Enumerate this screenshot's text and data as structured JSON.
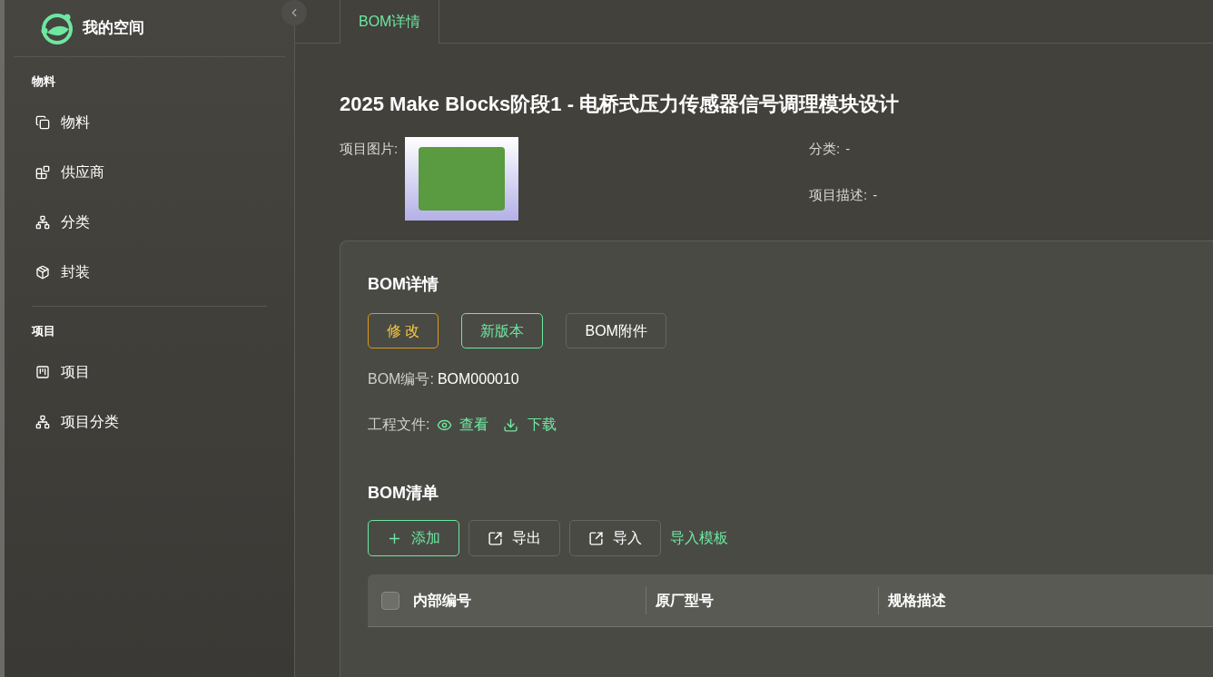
{
  "sidebar": {
    "title": "我的空间",
    "sections": [
      {
        "heading": "物料",
        "items": [
          {
            "label": "物料"
          },
          {
            "label": "供应商"
          },
          {
            "label": "分类"
          },
          {
            "label": "封装"
          }
        ]
      },
      {
        "heading": "项目",
        "items": [
          {
            "label": "项目"
          },
          {
            "label": "项目分类"
          }
        ]
      }
    ]
  },
  "tabs": [
    {
      "label": "BOM详情",
      "selected": true
    }
  ],
  "page_title": "2025 Make Blocks阶段1 - 电桥式压力传感器信号调理模块设计",
  "info": {
    "image_label": "项目图片:",
    "category_label": "分类:",
    "category_value": "-",
    "description_label": "项目描述:",
    "description_value": "-"
  },
  "bom_detail": {
    "heading": "BOM详情",
    "buttons": [
      {
        "label": "修 改",
        "kind": "warning"
      },
      {
        "label": "新版本",
        "kind": "primary"
      },
      {
        "label": "BOM附件",
        "kind": "default"
      }
    ],
    "number_label": "BOM编号:",
    "number_value": "BOM000010",
    "files_label": "工程文件:",
    "view_link": "查看",
    "download_link": "下载"
  },
  "bom_list": {
    "heading": "BOM清单",
    "buttons": [
      {
        "label": "添加",
        "kind": "primary"
      },
      {
        "label": "导出",
        "kind": "default"
      },
      {
        "label": "导入",
        "kind": "default"
      }
    ],
    "template_link": "导入模板",
    "table": {
      "select_all_checked": false,
      "columns": [
        "内部编号",
        "原厂型号",
        "规格描述"
      ]
    }
  }
}
